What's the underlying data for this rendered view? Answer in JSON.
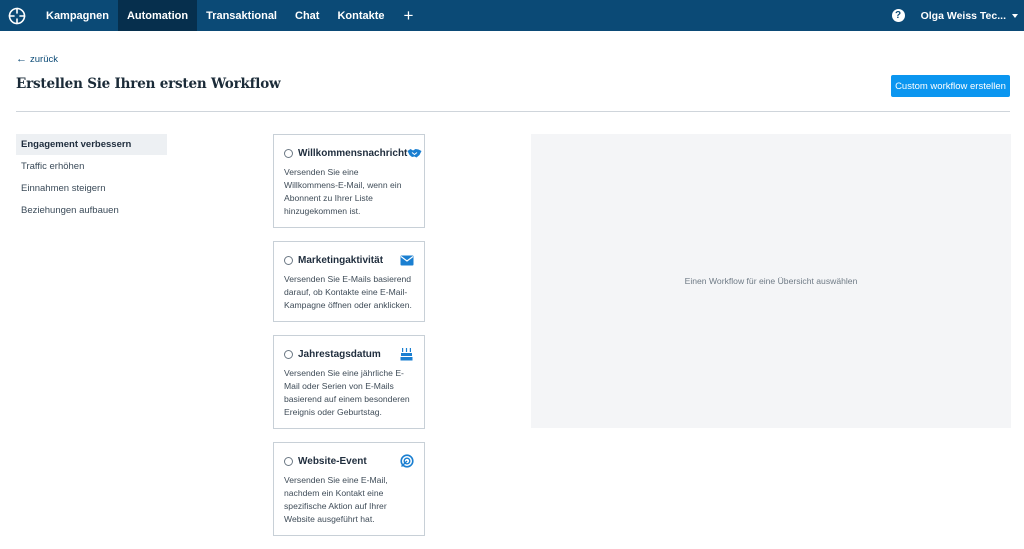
{
  "nav": {
    "logo_icon": "brand-logo-icon",
    "items": [
      {
        "label": "Kampagnen",
        "active": false
      },
      {
        "label": "Automation",
        "active": true
      },
      {
        "label": "Transaktional",
        "active": false
      },
      {
        "label": "Chat",
        "active": false
      },
      {
        "label": "Kontakte",
        "active": false
      }
    ],
    "plus_label": "+",
    "help_label": "?",
    "user_name": "Olga Weiss Tec..."
  },
  "header": {
    "back_label": "zurück",
    "title": "Erstellen Sie Ihren ersten Workflow",
    "create_button": "Custom workflow erstellen"
  },
  "sidebar": {
    "items": [
      {
        "label": "Engagement verbessern",
        "active": true
      },
      {
        "label": "Traffic erhöhen",
        "active": false
      },
      {
        "label": "Einnahmen steigern",
        "active": false
      },
      {
        "label": "Beziehungen aufbauen",
        "active": false
      }
    ]
  },
  "workflows": [
    {
      "title": "Willkommensnachricht",
      "icon": "handshake-icon",
      "description": "Versenden Sie eine Willkommens-E-Mail, wenn ein Abonnent zu Ihrer Liste hinzugekommen ist."
    },
    {
      "title": "Marketingaktivität",
      "icon": "envelope-icon",
      "description": "Versenden Sie E-Mails basierend darauf, ob Kontakte eine E-Mail-Kampagne öffnen oder anklicken."
    },
    {
      "title": "Jahrestagsdatum",
      "icon": "cake-icon",
      "description": "Versenden Sie eine jährliche E-Mail oder Serien von E-Mails basierend auf einem besonderen Ereignis oder Geburtstag."
    },
    {
      "title": "Website-Event",
      "icon": "target-icon",
      "description": "Versenden Sie eine E-Mail, nachdem ein Kontakt eine spezifische Aktion auf Ihrer Website ausgeführt hat."
    }
  ],
  "preview": {
    "placeholder": "Einen Workflow für eine Übersicht auswählen"
  },
  "colors": {
    "nav_bg": "#0b4a76",
    "nav_active_bg": "#062f4d",
    "primary": "#0b96f0",
    "icon_blue": "#1a7fd1"
  }
}
